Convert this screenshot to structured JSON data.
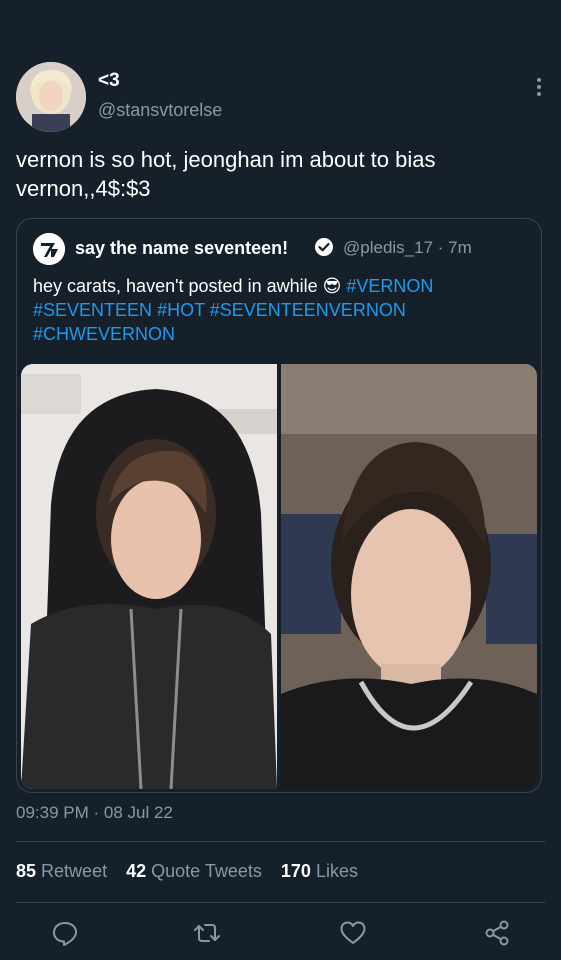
{
  "tweet": {
    "display_name": "<3",
    "handle": "@stansvtorelse",
    "text": "vernon is so hot, jeonghan im about to bias vernon,,4$:$3",
    "timestamp": "09:39 PM · 08 Jul 22"
  },
  "quoted": {
    "display_name": "say the name seventeen!",
    "handle_time": "@pledis_17 · 7m",
    "text_plain": "hey carats, haven't posted in awhile 😎 ",
    "hashtags": [
      "#VERNON",
      "#SEVENTEEN",
      "#HOT",
      "#SEVENTEENVERNON",
      "#CHWEVERNON"
    ]
  },
  "stats": {
    "retweets_count": "85",
    "retweets_label": "Retweet",
    "quotes_count": "42",
    "quotes_label": "Quote Tweets",
    "likes_count": "170",
    "likes_label": "Likes"
  },
  "icons": [
    "more-icon",
    "verified-icon",
    "reply-icon",
    "retweet-icon",
    "like-icon",
    "share-icon"
  ],
  "colors": {
    "background": "#15202b",
    "accent": "#1d9bf0",
    "muted": "#8899a6",
    "border": "#38444d"
  }
}
